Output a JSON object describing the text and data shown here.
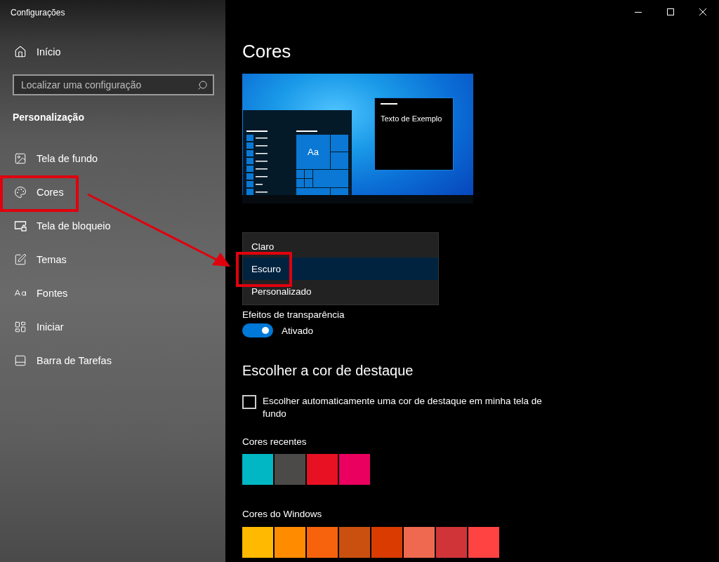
{
  "window": {
    "title": "Configurações"
  },
  "sidebar": {
    "home": "Início",
    "search": {
      "placeholder": "Localizar uma configuração"
    },
    "section": "Personalização",
    "items": [
      {
        "label": "Tela de fundo"
      },
      {
        "label": "Cores"
      },
      {
        "label": "Tela de bloqueio"
      },
      {
        "label": "Temas"
      },
      {
        "label": "Fontes"
      },
      {
        "label": "Iniciar"
      },
      {
        "label": "Barra de Tarefas"
      }
    ]
  },
  "page": {
    "title": "Cores",
    "preview": {
      "tile_label": "Aa",
      "window_text": "Texto de Exemplo"
    },
    "mode_dropdown": {
      "options": [
        {
          "label": "Claro",
          "selected": false
        },
        {
          "label": "Escuro",
          "selected": true
        },
        {
          "label": "Personalizado",
          "selected": false
        }
      ]
    },
    "transparency": {
      "label": "Efeitos de transparência",
      "on": true,
      "state_label": "Ativado"
    },
    "accent_heading": "Escolher a cor de destaque",
    "auto_accent": {
      "label": "Escolher automaticamente uma cor de destaque em minha tela de fundo",
      "checked": false
    },
    "recent_colors": {
      "label": "Cores recentes",
      "swatches": [
        {
          "color": "#00b7c3"
        },
        {
          "color": "#4c4a48"
        },
        {
          "color": "#e81123"
        },
        {
          "color": "#ea005e"
        }
      ]
    },
    "windows_colors": {
      "label": "Cores do Windows",
      "swatches": [
        {
          "color": "#ffb900"
        },
        {
          "color": "#ff8c00"
        },
        {
          "color": "#f7630c"
        },
        {
          "color": "#ca5010"
        },
        {
          "color": "#da3b01"
        },
        {
          "color": "#ef6950"
        },
        {
          "color": "#d13438"
        },
        {
          "color": "#ff4343"
        }
      ]
    }
  }
}
